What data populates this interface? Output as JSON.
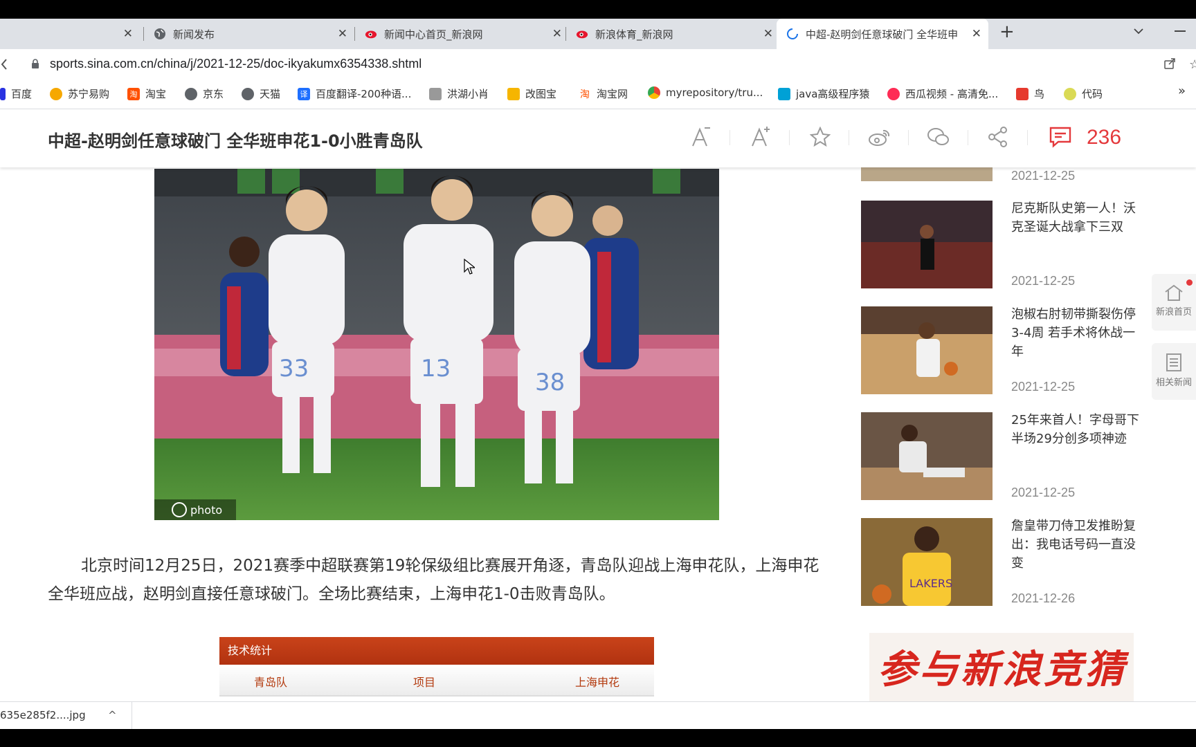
{
  "tabs": [
    {
      "label": "",
      "close": "✕"
    },
    {
      "label": "新闻发布",
      "close": "✕"
    },
    {
      "label": "新闻中心首页_新浪网",
      "close": "✕"
    },
    {
      "label": "新浪体育_新浪网",
      "close": "✕"
    },
    {
      "label": "中超-赵明剑任意球破门 全华班申",
      "close": "✕"
    }
  ],
  "new_tab": "+",
  "address": {
    "url": "sports.sina.com.cn/china/j/2021-12-25/doc-ikyakumx6354338.shtml"
  },
  "bookmarks": [
    {
      "label": "百度",
      "icon": "baidu-paw-icon",
      "color": "#2932e1"
    },
    {
      "label": "苏宁易购",
      "icon": "suning-lion-icon",
      "color": "#f6a800"
    },
    {
      "label": "淘宝",
      "icon": "taobao-icon",
      "color": "#ff5000"
    },
    {
      "label": "京东",
      "icon": "globe-icon",
      "color": "#5f6368"
    },
    {
      "label": "天猫",
      "icon": "globe-icon",
      "color": "#5f6368"
    },
    {
      "label": "百度翻译-200种语...",
      "icon": "translate-icon",
      "color": "#1e6fff"
    },
    {
      "label": "洪湖小肖",
      "icon": "bird-icon",
      "color": "#666666"
    },
    {
      "label": "改图宝",
      "icon": "image-icon",
      "color": "#f6b500"
    },
    {
      "label": "淘宝网",
      "icon": "taobao-icon",
      "color": "#ff5000"
    },
    {
      "label": "myrepository/tru...",
      "icon": "chrome-icon",
      "color": "#34a853"
    },
    {
      "label": "java高级程序猿",
      "icon": "bilibili-icon",
      "color": "#00a1d6"
    },
    {
      "label": "西瓜视频 - 高清免...",
      "icon": "xigua-icon",
      "color": "#fe2c55"
    },
    {
      "label": "鸟",
      "icon": "bird-red-icon",
      "color": "#e63a2e"
    },
    {
      "label": "代码",
      "icon": "code-icon",
      "color": "#c8c800"
    }
  ],
  "bookmarks_more": "»",
  "header": {
    "title": "中超-赵明剑任意球破门 全华班申花1-0小胜青岛队",
    "comment_count": "236"
  },
  "photo": {
    "watermark": "photo"
  },
  "article": {
    "paragraph": "北京时间12月25日，2021赛季中超联赛第19轮保级组比赛展开角逐，青岛队迎战上海申花队，上海申花全华班应战，赵明剑直接任意球破门。全场比赛结束，上海申花1-0击败青岛队。"
  },
  "stats": {
    "title": "技术统计",
    "col_home": "青岛队",
    "col_item": "项目",
    "col_away": "上海申花"
  },
  "sidebar": {
    "top_date": "2021-12-25",
    "items": [
      {
        "title": "尼克斯队史第一人！沃克圣诞大战拿下三双",
        "date": "2021-12-25"
      },
      {
        "title": "泡椒右肘韧带撕裂伤停3-4周 若手术将休战一年",
        "date": "2021-12-25"
      },
      {
        "title": "25年来首人！字母哥下半场29分创多项神迹",
        "date": "2021-12-25"
      },
      {
        "title": "詹皇带刀侍卫发推盼复出：我电话号码一直没变",
        "date": "2021-12-26"
      }
    ],
    "ad_text": "参与新浪竞猜"
  },
  "float_buttons": [
    {
      "label": "新浪首页"
    },
    {
      "label": "相关新闻"
    }
  ],
  "download": {
    "filename": "635e285f2....jpg",
    "chevron": "^"
  }
}
